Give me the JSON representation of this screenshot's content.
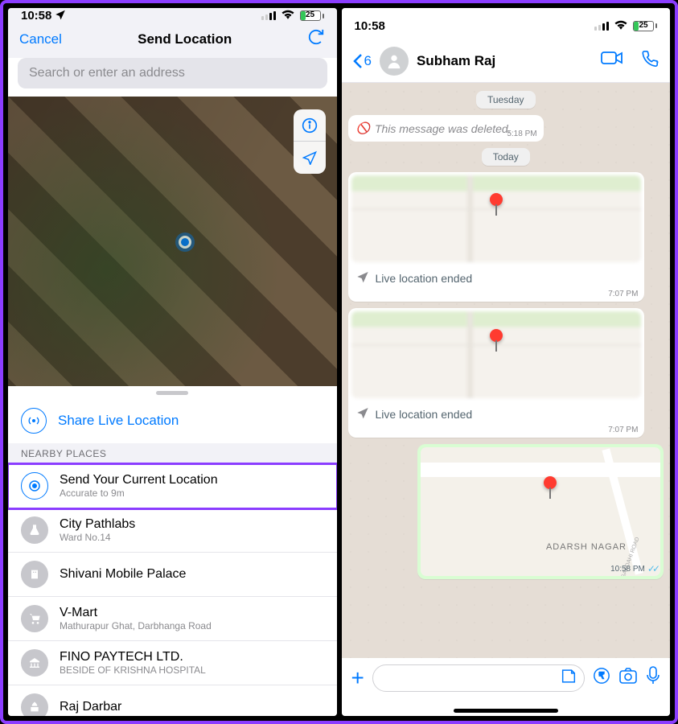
{
  "shared": {
    "time": "10:58",
    "battery": "25"
  },
  "left": {
    "cancel": "Cancel",
    "title": "Send Location",
    "search_placeholder": "Search or enter an address",
    "share_live": "Share Live Location",
    "nearby_header": "NEARBY PLACES",
    "places": [
      {
        "title": "Send Your Current Location",
        "sub": "Accurate to 9m"
      },
      {
        "title": "City Pathlabs",
        "sub": "Ward No.14"
      },
      {
        "title": "Shivani Mobile Palace",
        "sub": ""
      },
      {
        "title": "V-Mart",
        "sub": "Mathurapur Ghat, Darbhanga Road"
      },
      {
        "title": "FINO PAYTECH LTD.",
        "sub": "BESIDE OF KRISHNA HOSPITAL"
      },
      {
        "title": "Raj Darbar",
        "sub": ""
      }
    ]
  },
  "right": {
    "unread": "6",
    "contact": "Subham Raj",
    "date1": "Tuesday",
    "deleted_text": "This message was deleted.",
    "deleted_time": "5:18 PM",
    "date2": "Today",
    "live_ended": "Live location ended",
    "live_time": "7:07 PM",
    "sent_area": "ADARSH NAGAR",
    "sent_road": "MAGARDAHI ROAD",
    "sent_time": "10:58 PM"
  }
}
